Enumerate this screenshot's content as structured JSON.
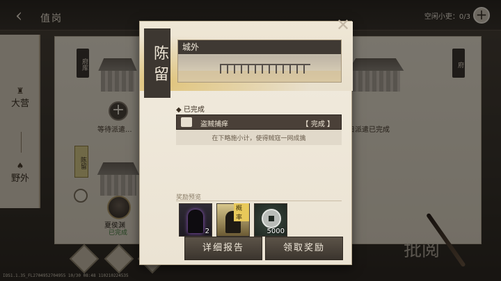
{
  "header": {
    "back_icon": "back-chevron-icon",
    "title": "值岗",
    "idle_clerks_label": "空闲小吏：0/3",
    "add_icon": "plus-icon"
  },
  "side_nav": {
    "tabs": [
      {
        "label": "大营",
        "icon": "camp-icon"
      },
      {
        "label": "野外",
        "icon": "field-icon"
      }
    ]
  },
  "scene": {
    "plaque_left": "府库",
    "plaque_right": "府",
    "waiting_text": "等待派遣...",
    "done_text": "日派遣已完成",
    "city_tag": "陈留",
    "general": {
      "name": "夏侯渊",
      "status": "已完成"
    },
    "bottom_buttons": [
      "",
      "",
      ""
    ],
    "stamp_text": "批阅",
    "version": "IOS1.1.35_FL2704952704955 10/30 08:48 110210224535"
  },
  "modal": {
    "city_name": "陈留",
    "location": "城外",
    "close_icon": "close-x-icon",
    "completed_header": "◆ 已完成",
    "task": {
      "icon": "scroll-icon",
      "name": "盗贼捕痒",
      "state": "【 完成 】",
      "description": "在下略施小计，使得贼寇一网成擒"
    },
    "reward_header": "奖励预览",
    "rewards": [
      {
        "icon": "purple-general-card-icon",
        "count": "2"
      },
      {
        "icon": "gold-general-card-icon",
        "tag": "概率",
        "count": ""
      },
      {
        "icon": "copper-coin-icon",
        "count": "5000"
      }
    ],
    "buttons": {
      "detail_report": "详细报告",
      "claim_reward": "领取奖励"
    }
  },
  "colors": {
    "dark_panel": "#3f3933",
    "paper": "#ebe3d3",
    "accent_gold": "#e0c47b",
    "status_green": "#3f7a3a"
  }
}
